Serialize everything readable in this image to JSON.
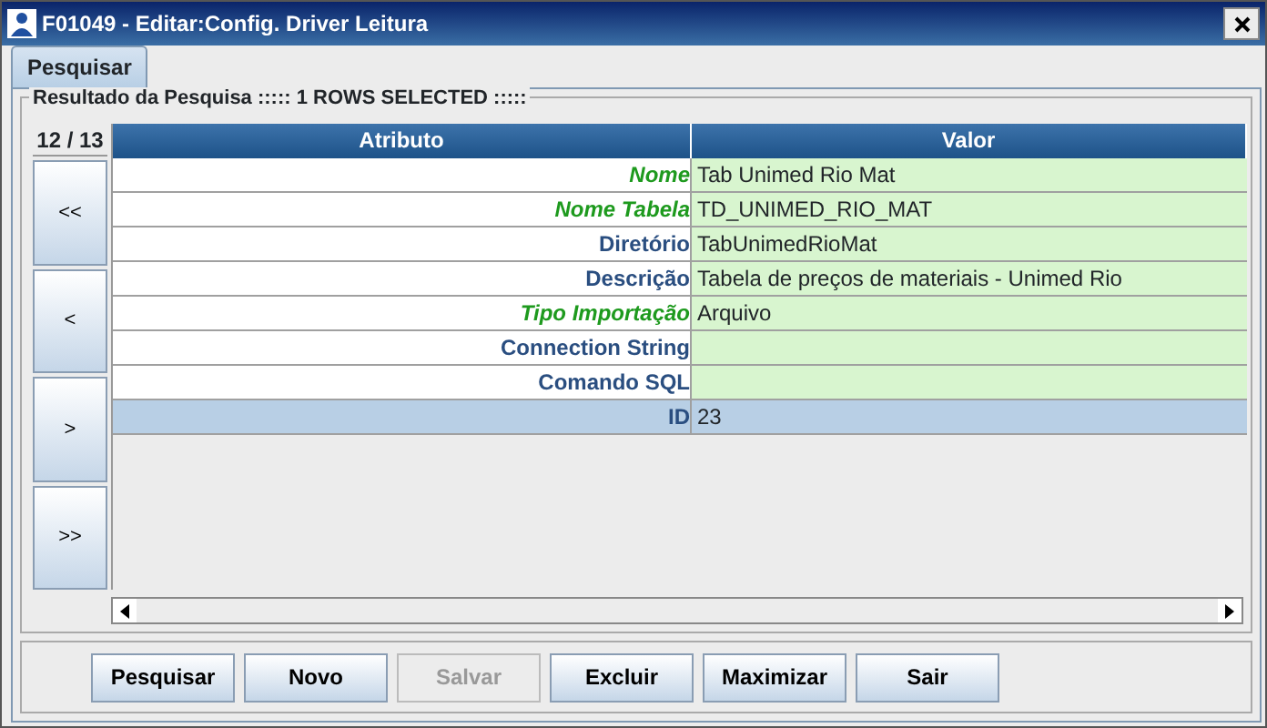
{
  "window": {
    "title": "F01049 - Editar:Config. Driver Leitura"
  },
  "tabs": [
    {
      "label": "Pesquisar",
      "selected": true
    }
  ],
  "results": {
    "legend": "Resultado da Pesquisa ::::: 1 ROWS SELECTED :::::",
    "counter": "12 / 13",
    "nav_buttons": [
      "<<",
      "<",
      ">",
      ">>"
    ],
    "columns": [
      "Atributo",
      "Valor"
    ],
    "rows": [
      {
        "attribute": "Nome",
        "value": "Tab Unimed Rio Mat",
        "required": true,
        "selected": false
      },
      {
        "attribute": "Nome Tabela",
        "value": "TD_UNIMED_RIO_MAT",
        "required": true,
        "selected": false
      },
      {
        "attribute": "Diretório",
        "value": "TabUnimedRioMat",
        "required": false,
        "selected": false
      },
      {
        "attribute": "Descrição",
        "value": "Tabela de preços de materiais - Unimed Rio",
        "required": false,
        "selected": false
      },
      {
        "attribute": "Tipo Importação",
        "value": "Arquivo",
        "required": true,
        "selected": false
      },
      {
        "attribute": "Connection String",
        "required": false,
        "selected": false
      },
      {
        "attribute": "Comando SQL",
        "required": false,
        "selected": false
      },
      {
        "attribute": "ID",
        "value": "23",
        "required": false,
        "selected": true
      }
    ]
  },
  "buttons": [
    {
      "label": "Pesquisar",
      "disabled": false
    },
    {
      "label": "Novo",
      "disabled": false
    },
    {
      "label": "Salvar",
      "disabled": true
    },
    {
      "label": "Excluir",
      "disabled": false
    },
    {
      "label": "Maximizar",
      "disabled": false
    },
    {
      "label": "Sair",
      "disabled": false
    }
  ]
}
